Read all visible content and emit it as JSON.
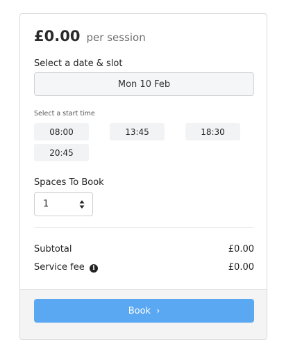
{
  "pricing": {
    "amount": "£0.00",
    "unit": "per session"
  },
  "date_section": {
    "label": "Select a date & slot",
    "selected_date": "Mon 10 Feb"
  },
  "time_section": {
    "label": "Select a start time",
    "slots": [
      "08:00",
      "13:45",
      "18:30",
      "20:45"
    ]
  },
  "spaces": {
    "label": "Spaces To Book",
    "value": "1"
  },
  "summary": {
    "subtotal_label": "Subtotal",
    "subtotal_value": "£0.00",
    "fee_label": "Service fee",
    "fee_value": "£0.00",
    "fee_icon": "info-icon"
  },
  "actions": {
    "book_label": "Book",
    "book_icon": "chevron-right-icon",
    "book_color": "#5aa7f2"
  }
}
